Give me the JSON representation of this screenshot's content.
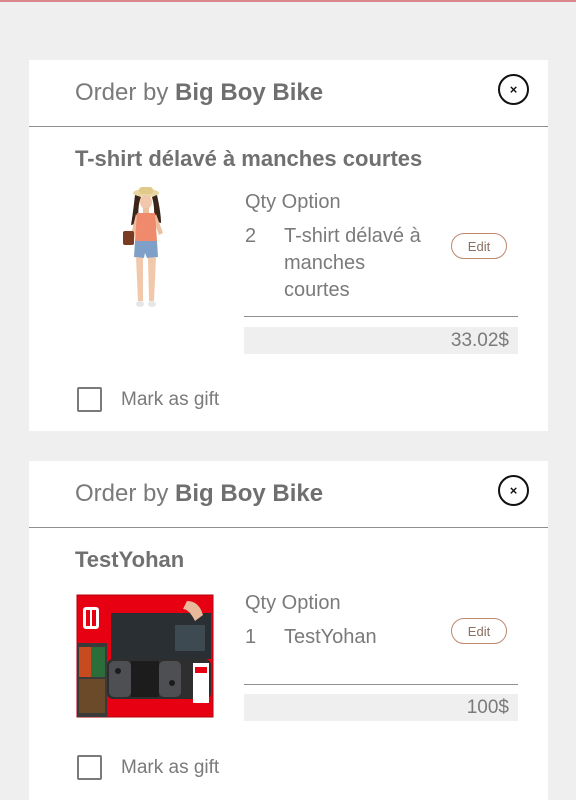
{
  "orders": [
    {
      "order_by_prefix": "Order by ",
      "shop": "Big Boy Bike",
      "close_glyph": "×",
      "product_title": "T-shirt délavé à manches courtes",
      "qty_header": "Qty Option",
      "qty": "2",
      "option": "T-shirt délavé à manches courtes",
      "edit_label": "Edit",
      "price": "33.02$",
      "gift_label": "Mark as gift",
      "image": "woman-in-tshirt-photo"
    },
    {
      "order_by_prefix": "Order by ",
      "shop": "Big Boy Bike",
      "close_glyph": "×",
      "product_title": "TestYohan",
      "qty_header": "Qty Option",
      "qty": "1",
      "option": "TestYohan",
      "edit_label": "Edit",
      "price": "100$",
      "gift_label": "Mark as gift",
      "image": "nintendo-switch-box-photo"
    }
  ],
  "colors": {
    "background": "#f0eff0",
    "card": "#ffffff",
    "accent_line": "#d9878a",
    "edit_border": "#c0876f",
    "price_bar": "#efefef"
  }
}
